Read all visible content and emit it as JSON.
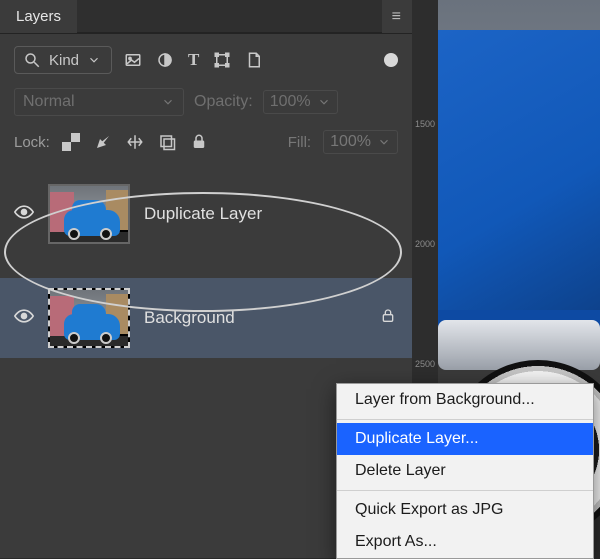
{
  "panel": {
    "title": "Layers"
  },
  "filter": {
    "kind_label": "Kind",
    "icons": [
      "image",
      "adjustment",
      "type",
      "shape",
      "smartobject"
    ]
  },
  "blend": {
    "mode": "Normal",
    "opacity_label": "Opacity:",
    "opacity_value": "100%"
  },
  "lock": {
    "label": "Lock:",
    "fill_label": "Fill:",
    "fill_value": "100%"
  },
  "layers": [
    {
      "name": "Duplicate Layer",
      "visible": true,
      "locked": false,
      "selected": false
    },
    {
      "name": "Background",
      "visible": true,
      "locked": true,
      "selected": true
    }
  ],
  "context_menu": {
    "items": [
      {
        "label": "Layer from Background...",
        "state": "enabled"
      },
      {
        "label": "Duplicate Layer...",
        "state": "hover"
      },
      {
        "label": "Delete Layer",
        "state": "enabled"
      },
      {
        "label": "Quick Export as JPG",
        "state": "enabled"
      },
      {
        "label": "Export As...",
        "state": "enabled"
      }
    ]
  },
  "ruler": {
    "major_ticks": [
      "1500",
      "2000",
      "2500"
    ]
  }
}
